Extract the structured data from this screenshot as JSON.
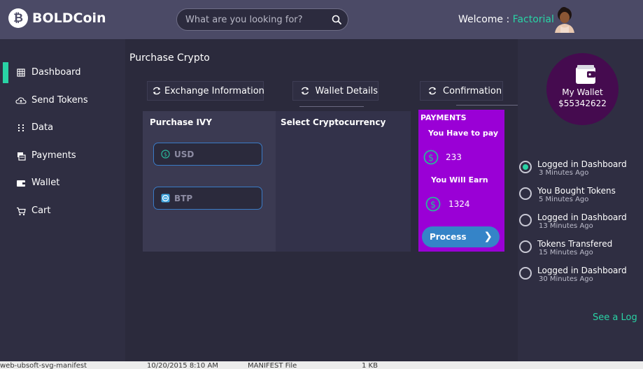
{
  "header": {
    "logo_glyph": "₿",
    "app_name": "BOLDCoin",
    "search_placeholder": "What are you looking for?",
    "welcome_label": "Welcome :",
    "user_name": "Factorial"
  },
  "sidebar": {
    "items": [
      {
        "label": "Dashboard",
        "icon": "grid-icon",
        "active": true
      },
      {
        "label": "Send Tokens",
        "icon": "cloud-icon",
        "active": false
      },
      {
        "label": "Data",
        "icon": "data-icon",
        "active": false
      },
      {
        "label": "Payments",
        "icon": "payments-icon",
        "active": false
      },
      {
        "label": "Wallet",
        "icon": "wallet-icon",
        "active": false
      },
      {
        "label": "Cart",
        "icon": "cart-icon",
        "active": false
      }
    ]
  },
  "main": {
    "title": "Purchase Crypto",
    "tabs": [
      {
        "label": "Exchange Information"
      },
      {
        "label": "Wallet Details"
      },
      {
        "label": "Confirmation"
      }
    ],
    "purchase": {
      "title": "Purchase IVY",
      "currency_1": "USD",
      "currency_2": "BTP"
    },
    "select": {
      "title": "Select Cryptocurrency"
    },
    "payments": {
      "title": "PAYMENTS",
      "pay_label": "You Have to pay",
      "pay_value": "233",
      "earn_label": "You Will Earn",
      "earn_value": "1324",
      "process_label": "Process",
      "process_arrow": "❯"
    }
  },
  "right": {
    "wallet_label": "My Wallet",
    "wallet_amount": "$55342622",
    "log": [
      {
        "title": "Logged in Dashboard",
        "time": "3 Minutes Ago",
        "selected": true
      },
      {
        "title": "You Bought Tokens",
        "time": "5 Minutes Ago",
        "selected": false
      },
      {
        "title": "Logged in Dashboard",
        "time": "13 Minutes Ago",
        "selected": false
      },
      {
        "title": "Tokens Transfered",
        "time": "15 Minutes Ago",
        "selected": false
      },
      {
        "title": "Logged in Dashboard",
        "time": "30 Minutes Ago",
        "selected": false
      }
    ],
    "see_log": "See a Log"
  },
  "bottom_strip": {
    "text_1": "web-ubsoft-svg-manifest",
    "text_2": "10/20/2015 8:10 AM",
    "text_3": "MANIFEST File",
    "text_4": "1 KB"
  },
  "colors": {
    "accent": "#29d3a5",
    "header_bg": "#4b4a66",
    "payments_bg": "#9a00d6",
    "process_button": "#3584c8",
    "wallet_circle": "#450b4f"
  }
}
